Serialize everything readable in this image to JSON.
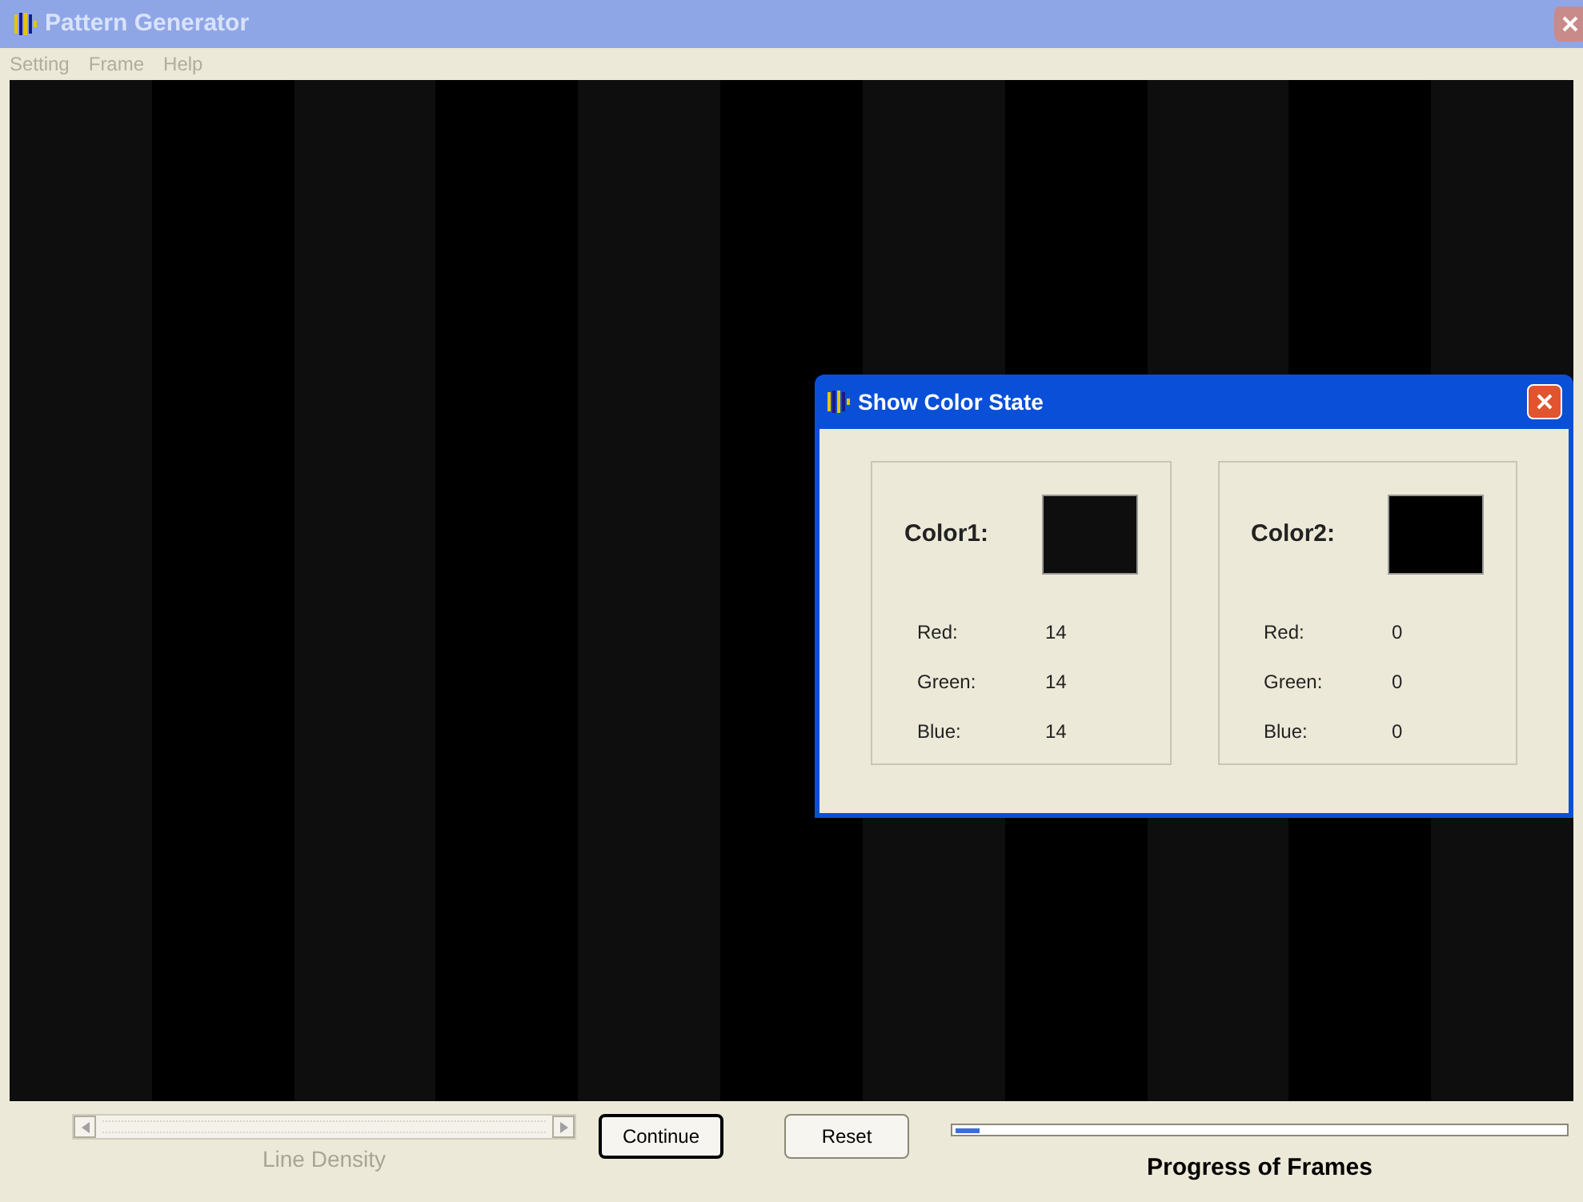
{
  "window": {
    "title": "Pattern Generator",
    "active": false
  },
  "menu": [
    "Setting",
    "Frame",
    "Help"
  ],
  "dialog": {
    "title": "Show Color State",
    "colors": [
      {
        "label": "Color1:",
        "channels": [
          {
            "name": "Red:",
            "value": "14"
          },
          {
            "name": "Green:",
            "value": "14"
          },
          {
            "name": "Blue:",
            "value": "14"
          }
        ],
        "color": "#0e0e0e"
      },
      {
        "label": "Color2:",
        "channels": [
          {
            "name": "Red:",
            "value": "0"
          },
          {
            "name": "Green:",
            "value": "0"
          },
          {
            "name": "Blue:",
            "value": "0"
          }
        ],
        "color": "#000000"
      }
    ]
  },
  "controls": {
    "slider": {
      "label": "Line Density",
      "disabled": true
    },
    "buttons": [
      {
        "label": "Continue",
        "focused": true
      },
      {
        "label": "Reset",
        "focused": false
      }
    ],
    "progress": {
      "label": "Progress of Frames",
      "level": 0.04
    }
  }
}
